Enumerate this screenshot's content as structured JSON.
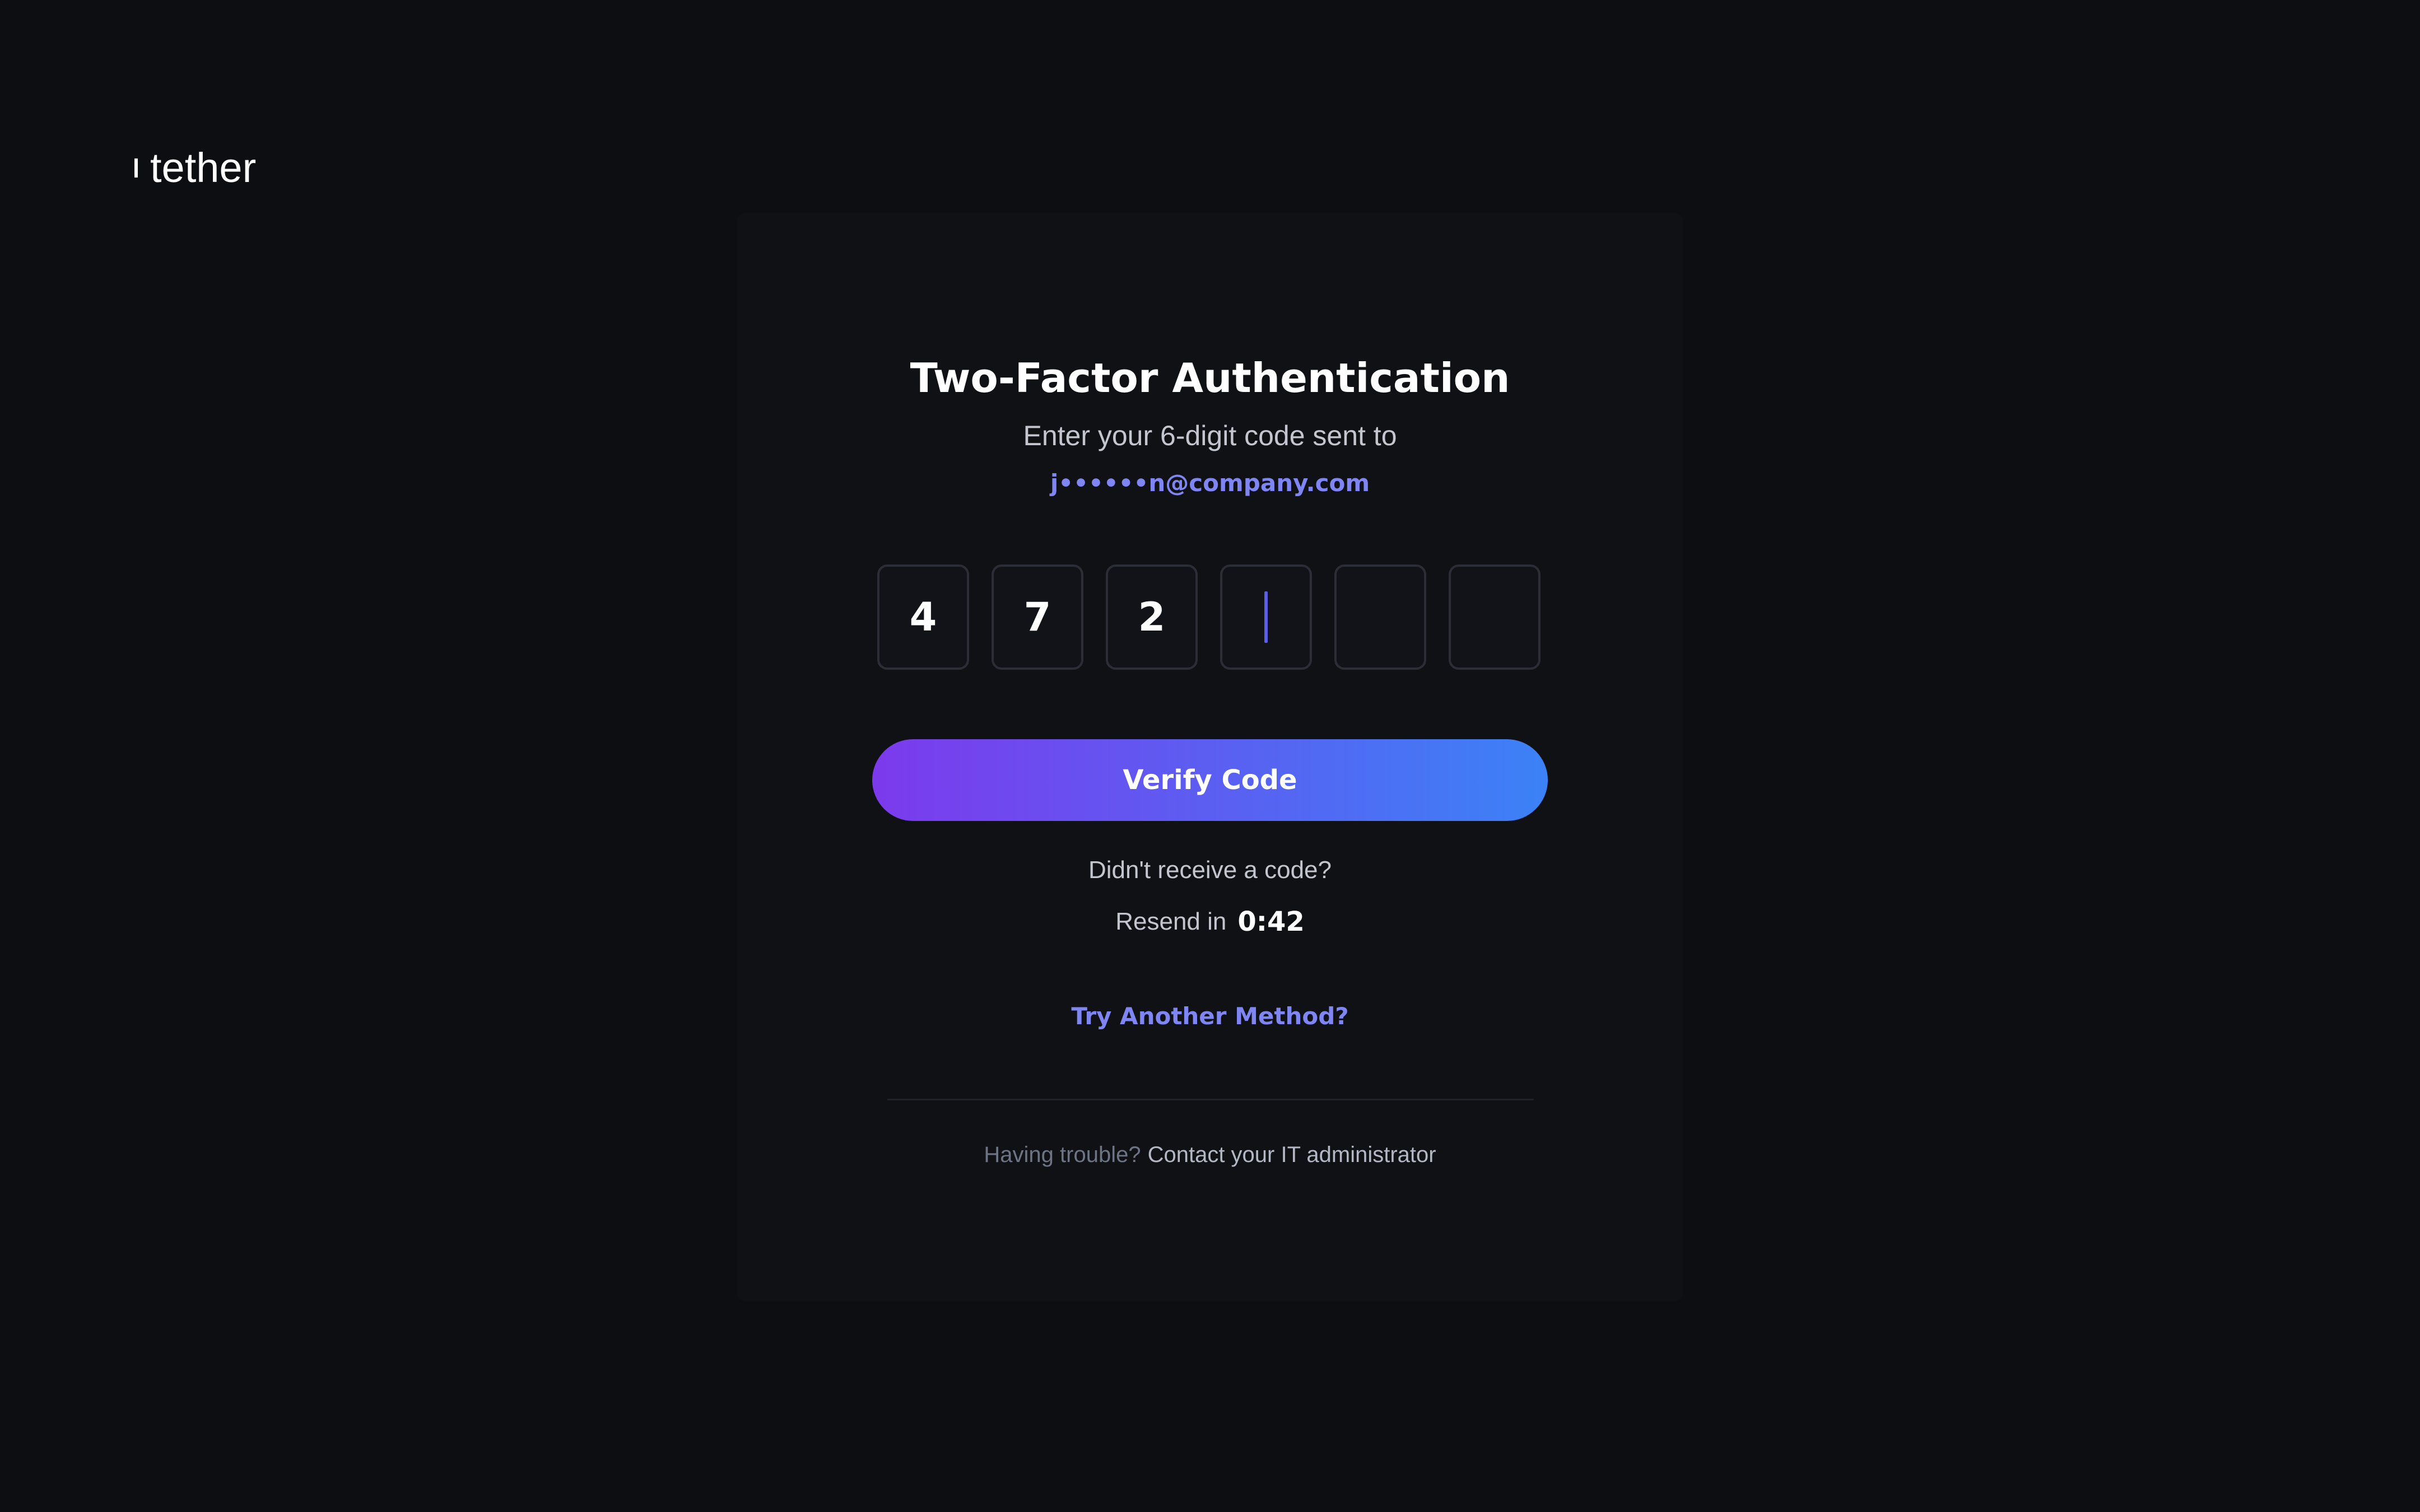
{
  "brand": {
    "name": "tether"
  },
  "auth": {
    "title": "Two-Factor Authentication",
    "subtitle": "Enter your 6-digit code sent to",
    "email_masked": "j••••••n@company.com",
    "code_digits": [
      "4",
      "7",
      "2",
      "",
      "",
      ""
    ],
    "active_digit_index": 3,
    "verify_button_label": "Verify Code",
    "no_code_prompt": "Didn't receive a code?",
    "resend_label": "Resend in",
    "resend_timer": "0:42",
    "another_method_link": "Try Another Method?",
    "trouble_label": "Having trouble?",
    "trouble_link": "Contact your IT administrator"
  },
  "colors": {
    "background": "#0d0e12",
    "card": "#0f1115",
    "accent_link": "#7f86f3",
    "button_gradient_start": "#7c3aed",
    "button_gradient_end": "#3b82f6",
    "caret": "#5a5fe8"
  }
}
